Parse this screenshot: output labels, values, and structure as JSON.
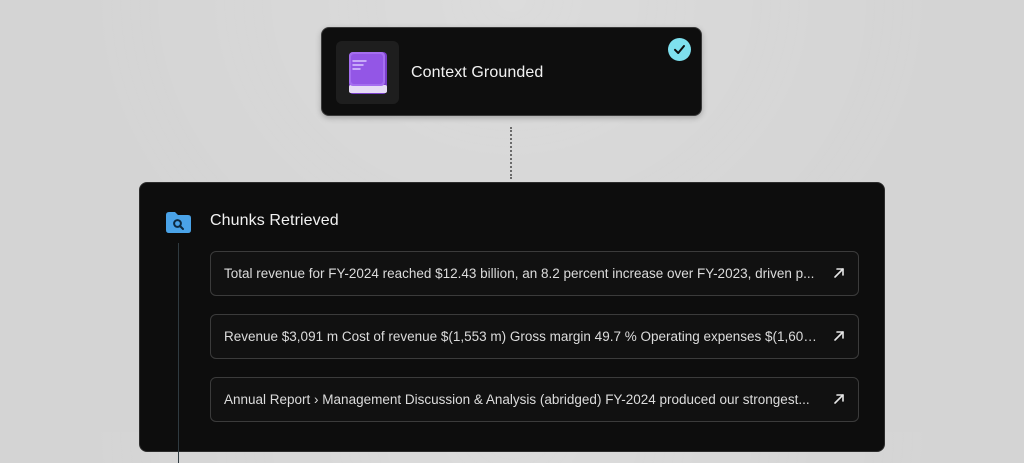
{
  "grounded_card": {
    "title": "Context Grounded",
    "icon": "book-icon",
    "status_icon": "check-circle-icon",
    "colors": {
      "icon_purple": "#9b5de5",
      "check_cyan": "#7ee0ee"
    }
  },
  "chunks_panel": {
    "title": "Chunks Retrieved",
    "icon": "folder-search-icon",
    "colors": {
      "icon_blue": "#4aa3e8"
    },
    "chunks": [
      {
        "text": "Total revenue for FY-2024 reached $12.43 billion, an 8.2 percent increase over FY-2023, driven p...",
        "icon": "arrow-up-right-icon"
      },
      {
        "text": "Revenue $3,091 m Cost of revenue $(1,553 m) Gross margin 49.7 % Operating expenses $(1,602...",
        "icon": "arrow-up-right-icon"
      },
      {
        "text": "Annual Report › Management Discussion & Analysis (abridged) FY-2024 produced our strongest...",
        "icon": "arrow-up-right-icon"
      }
    ]
  }
}
